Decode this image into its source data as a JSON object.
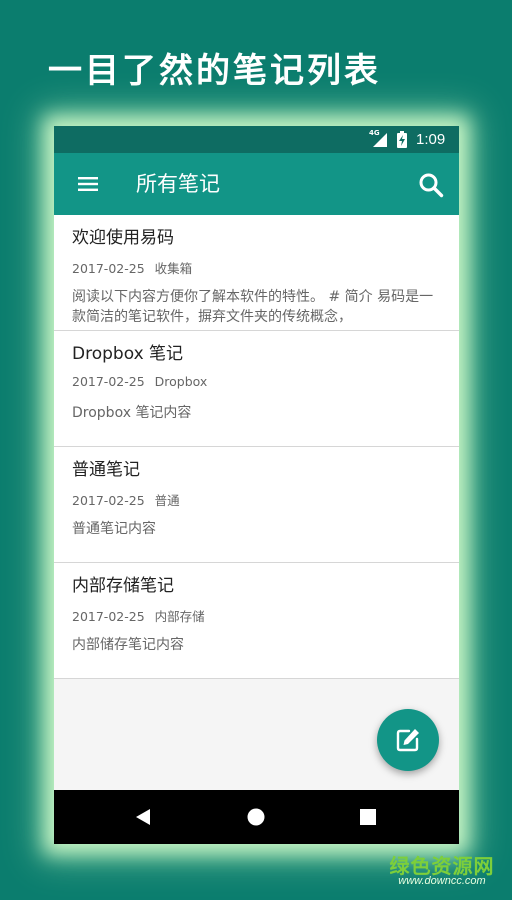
{
  "headline": "一目了然的笔记列表",
  "status_bar": {
    "network": "4G",
    "time": "1:09"
  },
  "app_bar": {
    "title": "所有笔记",
    "menu_icon": "hamburger-menu-icon",
    "search_icon": "search-icon"
  },
  "notes": [
    {
      "title": "欢迎使用易码",
      "date": "2017-02-25",
      "notebook": "收集箱",
      "preview": "阅读以下内容方便你了解本软件的特性。 # 简介 易码是一款简洁的笔记软件，摒弃文件夹的传统概念，"
    },
    {
      "title": "Dropbox 笔记",
      "date": "2017-02-25",
      "notebook": "Dropbox",
      "preview": "Dropbox 笔记内容"
    },
    {
      "title": "普通笔记",
      "date": "2017-02-25",
      "notebook": "普通",
      "preview": "普通笔记内容"
    },
    {
      "title": "内部存储笔记",
      "date": "2017-02-25",
      "notebook": "内部存储",
      "preview": "内部储存笔记内容"
    }
  ],
  "fab": {
    "icon": "edit-note-icon"
  },
  "nav_bar": {
    "back_icon": "back-triangle-icon",
    "home_icon": "home-circle-icon",
    "recents_icon": "recents-square-icon"
  },
  "watermark": {
    "name": "绿色资源网",
    "url": "www.downcc.com"
  },
  "colors": {
    "background": "#0b7d6e",
    "status_bar": "#0e6c62",
    "app_bar": "#129587",
    "fab": "#129587",
    "nav_bar": "#000000"
  }
}
